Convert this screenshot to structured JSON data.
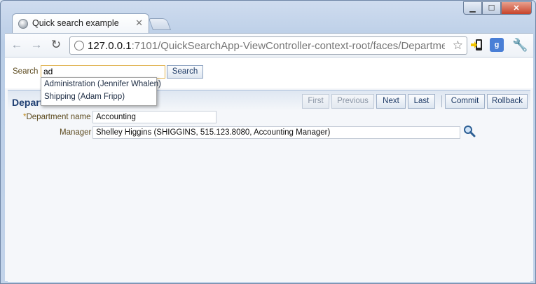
{
  "browser": {
    "tab_title": "Quick search example",
    "url_host": "127.0.0.1",
    "url_rest": ":7101/QuickSearchApp-ViewController-context-root/faces/Departme",
    "ext2_label": "g"
  },
  "search": {
    "label": "Search",
    "value": "ad",
    "button": "Search",
    "suggestions": [
      "Administration (Jennifer Whalen)",
      "Shipping (Adam Fripp)"
    ]
  },
  "panel": {
    "title": "Depart",
    "buttons": {
      "first": "First",
      "previous": "Previous",
      "next": "Next",
      "last": "Last",
      "commit": "Commit",
      "rollback": "Rollback"
    }
  },
  "form": {
    "department_label": "Department name",
    "department_value": "Accounting",
    "manager_label": "Manager",
    "manager_value": "Shelley Higgins (SHIGGINS, 515.123.8080, Accounting Manager)"
  }
}
